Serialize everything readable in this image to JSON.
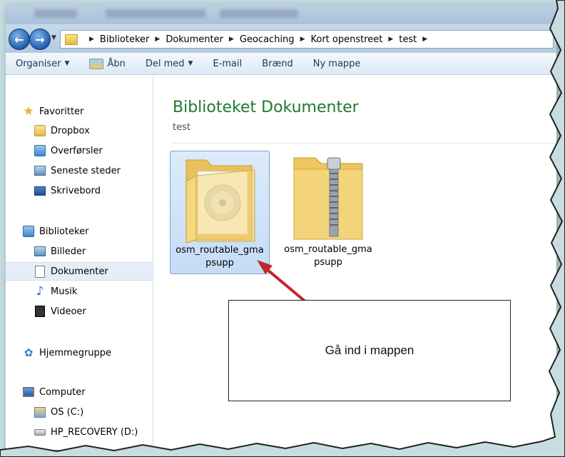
{
  "address": {
    "breadcrumbs": [
      "Biblioteker",
      "Dokumenter",
      "Geocaching",
      "Kort openstreet",
      "test"
    ]
  },
  "commands": {
    "organise": "Organiser",
    "open": "Åbn",
    "share": "Del med",
    "email": "E-mail",
    "burn": "Brænd",
    "new_folder": "Ny mappe"
  },
  "nav": {
    "favorites_header": "Favoritter",
    "dropbox": "Dropbox",
    "downloads": "Overførsler",
    "recent": "Seneste steder",
    "desktop": "Skrivebord",
    "libraries_header": "Biblioteker",
    "pictures": "Billeder",
    "documents": "Dokumenter",
    "music": "Musik",
    "videos": "Videoer",
    "homegroup": "Hjemmegruppe",
    "computer_header": "Computer",
    "os_drive": "OS (C:)",
    "recovery_drive": "HP_RECOVERY (D:)"
  },
  "content": {
    "title": "Biblioteket Dokumenter",
    "subtitle": "test",
    "items": [
      {
        "name": "osm_routable_gmapsupp",
        "type": "disc-folder",
        "selected": true
      },
      {
        "name": "osm_routable_gmapsupp",
        "type": "zip-folder",
        "selected": false
      }
    ]
  },
  "callout": {
    "text": "Gå ind i mappen",
    "arrow_color": "#c0272d"
  },
  "colors": {
    "library_title": "#1e7a30",
    "accent": "#1f5fae"
  }
}
